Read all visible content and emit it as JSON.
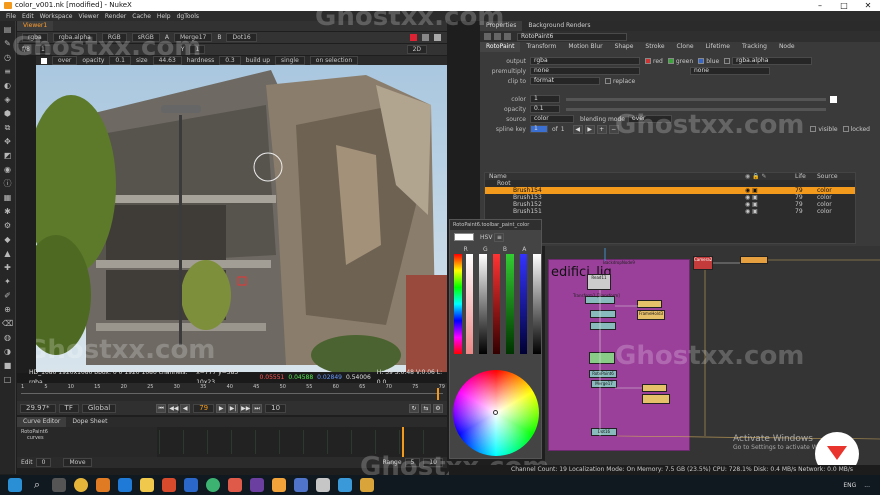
{
  "window": {
    "title": "color_v001.nk [modified] - NukeX"
  },
  "menu": [
    "File",
    "Edit",
    "Workspace",
    "Viewer",
    "Render",
    "Cache",
    "Help",
    "dgTools"
  ],
  "viewer": {
    "tab": "Viewer1",
    "channels": "rgba",
    "alpha": "rgba.alpha",
    "colorspace": "RGB",
    "srgb": "sRGB",
    "input_a": "A",
    "input_a_node": "Merge17",
    "input_b": "B",
    "input_b_node": "Dot16",
    "frame_label": "f/8",
    "frame_value": "1",
    "y_label": "Y",
    "y_value": "1",
    "view_mode": "2D",
    "paint_mode": "over",
    "opacity_label": "opacity",
    "opacity_value": "0.1",
    "size_label": "size",
    "size_value": "44.63",
    "hardness_label": "hardness",
    "hardness_value": "0.3",
    "build_up": "build up",
    "stroke_mode": "single",
    "on_selection": "on selection",
    "info_format": "HD_1080 1920x1080  bbox: 0 0 1920 1080 channels: rgba",
    "info_coords": "x=777 y=585 10x23",
    "info_r": "0.05551",
    "info_g": "0.04588",
    "info_b": "0.02849",
    "info_a": "0.54006",
    "info_hsv": "H: 39 S:0.48 V:0.06 L: 0.0",
    "fps": "29.97*",
    "tf": "TF",
    "global": "Global",
    "current_frame": "79",
    "frame_step": "10",
    "timeline_ticks": [
      "1",
      "5",
      "10",
      "15",
      "20",
      "25",
      "30",
      "35",
      "40",
      "45",
      "50",
      "55",
      "60",
      "65",
      "70",
      "75"
    ],
    "timeline_end": "79"
  },
  "curve_editor": {
    "tabs": [
      "Curve Editor",
      "Dope Sheet"
    ],
    "tree": [
      "RotoPaint6",
      "curves"
    ],
    "bottom_edit": "Edit",
    "bottom_count": "0",
    "move_btn": "Move",
    "range_label": "Range",
    "range_from": "5",
    "range_to": "10"
  },
  "properties": {
    "tabs": [
      "Properties",
      "Background Renders"
    ],
    "node_name": "RotoPaint6",
    "subtabs": [
      "RotoPaint",
      "Transform",
      "Motion Blur",
      "Shape",
      "Stroke",
      "Clone",
      "Lifetime",
      "Tracking",
      "Node"
    ],
    "output_label": "output",
    "output_value": "rgba",
    "output_red": "red",
    "output_green": "green",
    "output_blue": "blue",
    "output_alpha": "rgba.alpha",
    "premultiply_label": "premultiply",
    "premultiply_value": "none",
    "premultiply_value2": "none",
    "clip_label": "clip to",
    "clip_value": "format",
    "replace": "replace",
    "color_label": "color",
    "color_value": "1",
    "opacity_label": "opacity",
    "opacity_value": "0.1",
    "source_label": "source",
    "source_value": "color",
    "blending_label": "blending mode",
    "blending_value": "over",
    "spline_label": "spline key",
    "spline_value": "1",
    "spline_of": "of",
    "spline_total": "1",
    "visible": "visible",
    "locked": "locked",
    "layer_headers": {
      "name": "Name",
      "life": "Life",
      "source": "Source"
    },
    "layers": [
      {
        "name": "Root",
        "life": "",
        "source": ""
      },
      {
        "name": "Brush154",
        "life": "79",
        "source": "color"
      },
      {
        "name": "Brush153",
        "life": "79",
        "source": "color"
      },
      {
        "name": "Brush152",
        "life": "79",
        "source": "color"
      },
      {
        "name": "Brush151",
        "life": "79",
        "source": "color"
      }
    ]
  },
  "color_picker": {
    "title": "RotoPaint6.toolbar_paint_color",
    "mode": "HSV",
    "channels": [
      "R",
      "G",
      "B",
      "A"
    ]
  },
  "node_graph": {
    "backdrop_label": "BackdropNode9",
    "backdrop_title": "edifici_ljq",
    "camera_node": "Camera2",
    "read_node": "Read11",
    "transform_label": "Transform1 [Transform]",
    "frame_hold": "FrameHold3",
    "nodes": [
      "RotoPaint6",
      "Merge17",
      "Dot16"
    ]
  },
  "status": {
    "text": "Channel Count: 19  Localization Mode: On  Memory: 7.5 GB (23.5%)  CPU: 728.1%  Disk: 0.4 MB/s  Network: 0.0 MB/s"
  },
  "activate_windows": {
    "title": "Activate Windows",
    "subtitle": "Go to Settings to activate Windows."
  },
  "watermark": "Ghostxx.com",
  "taskbar": {
    "lang": "ENG",
    "time": "..."
  },
  "colors": {
    "accent_orange": "#f39a1c",
    "backdrop_purple": "#9a3f9a",
    "camera_red": "#c43b3b",
    "selected_row": "#f39a1c"
  }
}
